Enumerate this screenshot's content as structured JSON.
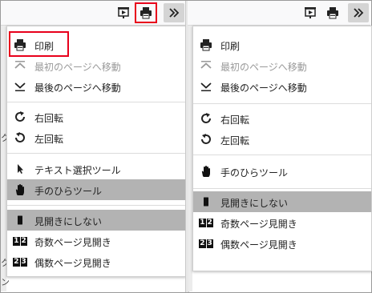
{
  "left_panel": {
    "menu": {
      "print": "印刷",
      "first_page": "最初のページへ移動",
      "last_page": "最後のページへ移動",
      "rotate_cw": "右回転",
      "rotate_ccw": "左回転",
      "text_select": "テキスト選択ツール",
      "hand_tool": "手のひらツール",
      "no_spread": "見開きにしない",
      "odd_spread": "奇数ページ見開き",
      "even_spread": "偶数ページ見開き"
    },
    "odd_num": [
      "1",
      "2"
    ],
    "even_num": [
      "2",
      "3"
    ],
    "bg_text": [
      "ク",
      "ク",
      "ン"
    ]
  },
  "right_panel": {
    "menu": {
      "print": "印刷",
      "first_page": "最初のページへ移動",
      "last_page": "最後のページへ移動",
      "rotate_cw": "右回転",
      "rotate_ccw": "左回転",
      "hand_tool": "手のひらツール",
      "no_spread": "見開きにしない",
      "odd_spread": "奇数ページ見開き",
      "even_spread": "偶数ページ見開き"
    },
    "odd_num": [
      "1",
      "2"
    ],
    "even_num": [
      "2",
      "3"
    ]
  },
  "colors": {
    "highlight": "#e8001b",
    "selected_bg": "#b3b3b3",
    "disabled_text": "#9a9a9a"
  }
}
